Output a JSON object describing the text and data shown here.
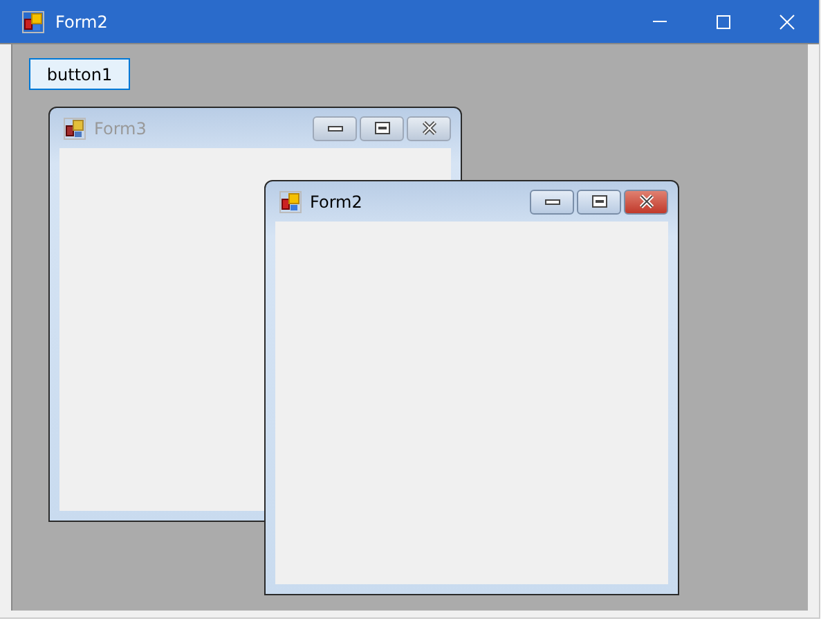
{
  "window": {
    "title": "Form2"
  },
  "button": {
    "label": "button1",
    "focused": true
  },
  "mdi_children": [
    {
      "title": "Form3",
      "active": false
    },
    {
      "title": "Form2",
      "active": true
    }
  ]
}
